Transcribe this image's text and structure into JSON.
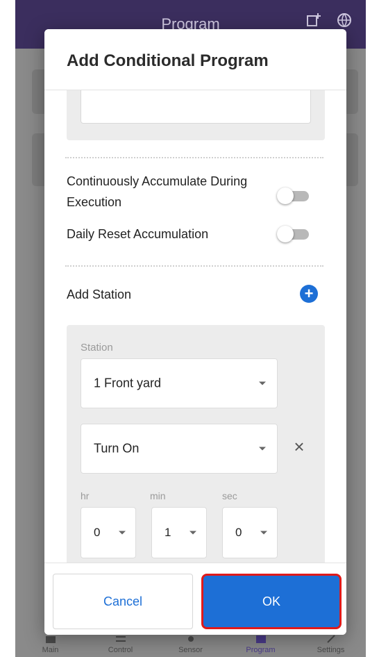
{
  "app_bar": {
    "title": "Program",
    "icons": [
      "add-chart-icon",
      "globe-icon"
    ]
  },
  "bottom_nav": {
    "items": [
      {
        "label": "Main",
        "icon": "home-icon"
      },
      {
        "label": "Control",
        "icon": "control-icon"
      },
      {
        "label": "Sensor",
        "icon": "sensor-icon"
      },
      {
        "label": "Program",
        "icon": "program-icon",
        "active": true
      },
      {
        "label": "Settings",
        "icon": "settings-icon"
      }
    ]
  },
  "dialog": {
    "title": "Add Conditional Program",
    "options": [
      {
        "label": "Continuously Accumulate During Execution",
        "enabled": false
      },
      {
        "label": "Daily Reset Accumulation",
        "enabled": false
      }
    ],
    "add_station_label": "Add Station",
    "add_station_icon": "plus-circle-icon",
    "station": {
      "caption": "Station",
      "station_value": "1 Front yard",
      "action_value": "Turn On",
      "remove_icon": "close-icon",
      "time": {
        "hr_label": "hr",
        "hr_value": "0",
        "min_label": "min",
        "min_value": "1",
        "sec_label": "sec",
        "sec_value": "0"
      }
    },
    "cancel_label": "Cancel",
    "ok_label": "OK"
  },
  "colors": {
    "primary": "#1d6fd6",
    "app_bar": "#3b2e5e",
    "highlight": "#e01a1a"
  }
}
